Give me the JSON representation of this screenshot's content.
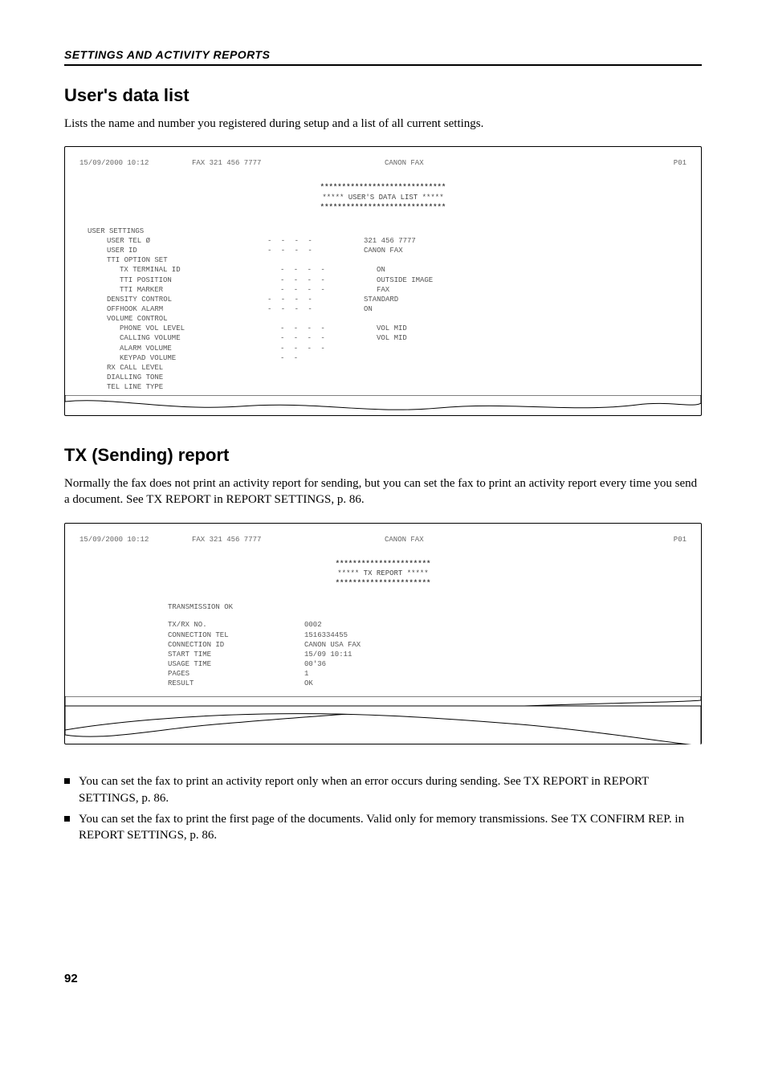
{
  "header": "SETTINGS AND ACTIVITY REPORTS",
  "section1": {
    "title": "User's data list",
    "intro": "Lists the name and number you registered during setup and a list of all current settings.",
    "printout": {
      "top": {
        "date": "15/09/2000 10:12",
        "fax": "FAX 321 456 7777",
        "name": "CANON FAX",
        "page": "P01"
      },
      "titleStarsTop": "*****************************",
      "titleMid": "*****   USER'S DATA LIST   *****",
      "titleStarsBot": "*****************************",
      "groupLabel": "USER SETTINGS",
      "rows": [
        {
          "indent": 1,
          "label": "USER TEL Ø",
          "dots": "- - - -",
          "value": "321 456 7777"
        },
        {
          "indent": 1,
          "label": "USER ID",
          "dots": "- - - -",
          "value": "CANON FAX"
        },
        {
          "indent": 1,
          "label": "TTI OPTION SET",
          "dots": "",
          "value": ""
        },
        {
          "indent": 2,
          "label": "TX TERMINAL ID",
          "dots": "- - - -",
          "value": "ON"
        },
        {
          "indent": 2,
          "label": "TTI POSITION",
          "dots": "- - - -",
          "value": "OUTSIDE IMAGE"
        },
        {
          "indent": 2,
          "label": "TTI MARKER",
          "dots": "- - - -",
          "value": "FAX"
        },
        {
          "indent": 1,
          "label": "DENSITY CONTROL",
          "dots": "- - - -",
          "value": "STANDARD"
        },
        {
          "indent": 1,
          "label": "OFFHOOK ALARM",
          "dots": "- - - -",
          "value": "ON"
        },
        {
          "indent": 1,
          "label": "VOLUME CONTROL",
          "dots": "",
          "value": ""
        },
        {
          "indent": 2,
          "label": "PHONE VOL LEVEL",
          "dots": "- - - -",
          "value": "VOL MID"
        },
        {
          "indent": 2,
          "label": "CALLING VOLUME",
          "dots": "- - - -",
          "value": "VOL MID"
        },
        {
          "indent": 2,
          "label": "ALARM VOLUME",
          "dots": "- - - -",
          "value": ""
        },
        {
          "indent": 2,
          "label": "KEYPAD VOLUME",
          "dots": "- -",
          "value": ""
        },
        {
          "indent": 1,
          "label": "RX CALL LEVEL",
          "dots": "",
          "value": ""
        },
        {
          "indent": 1,
          "label": "DIALLING TONE",
          "dots": "",
          "value": ""
        },
        {
          "indent": 1,
          "label": "TEL LINE TYPE",
          "dots": "",
          "value": ""
        }
      ]
    }
  },
  "section2": {
    "title": "TX (Sending) report",
    "intro": "Normally the fax does not print an activity report for sending, but you can set the fax to print an activity report every time you send a document. See TX REPORT in REPORT SETTINGS, p. 86.",
    "printout": {
      "top": {
        "date": "15/09/2000 10:12",
        "fax": "FAX 321 456 7777",
        "name": "CANON FAX",
        "page": "P01"
      },
      "titleStarsTop": "**********************",
      "titleMid": "*****   TX REPORT   *****",
      "titleStarsBot": "**********************",
      "status": "TRANSMISSION OK",
      "fields": [
        {
          "k": "TX/RX NO.",
          "v": "0002"
        },
        {
          "k": "CONNECTION TEL",
          "v": "1516334455"
        },
        {
          "k": "CONNECTION ID",
          "v": "CANON USA FAX"
        },
        {
          "k": "START TIME",
          "v": "15/09 10:11"
        },
        {
          "k": "USAGE TIME",
          "v": "00'36"
        },
        {
          "k": "PAGES",
          "v": "  1"
        },
        {
          "k": "RESULT",
          "v": "OK"
        }
      ]
    },
    "notes": [
      "You can set the fax to print an activity report only when an error occurs during sending. See TX REPORT in REPORT SETTINGS, p. 86.",
      "You can set the fax to print the first page of the documents. Valid only for memory transmissions. See TX CONFIRM REP. in REPORT SETTINGS, p. 86."
    ]
  },
  "pageNumber": "92"
}
